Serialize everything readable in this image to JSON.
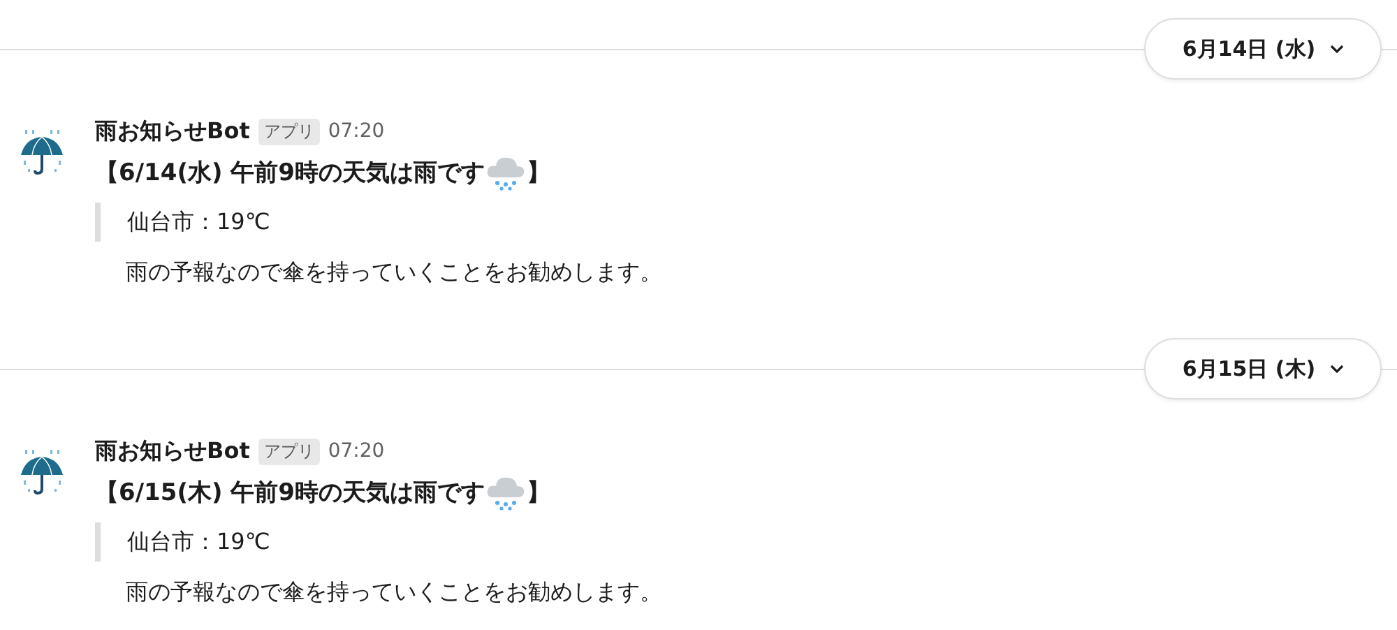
{
  "days": [
    {
      "date_label": "6月14日 (水)",
      "message": {
        "sender": "雨お知らせBot",
        "badge": "アプリ",
        "time": "07:20",
        "title": "【6/14(水) 午前9時の天気は雨です",
        "title_end": "】",
        "quote": "仙台市：19℃",
        "body": "雨の予報なので傘を持っていくことをお勧めします。"
      }
    },
    {
      "date_label": "6月15日 (木)",
      "message": {
        "sender": "雨お知らせBot",
        "badge": "アプリ",
        "time": "07:20",
        "title": "【6/15(木) 午前9時の天気は雨です",
        "title_end": "】",
        "quote": "仙台市：19℃",
        "body": "雨の予報なので傘を持っていくことをお勧めします。"
      }
    }
  ]
}
